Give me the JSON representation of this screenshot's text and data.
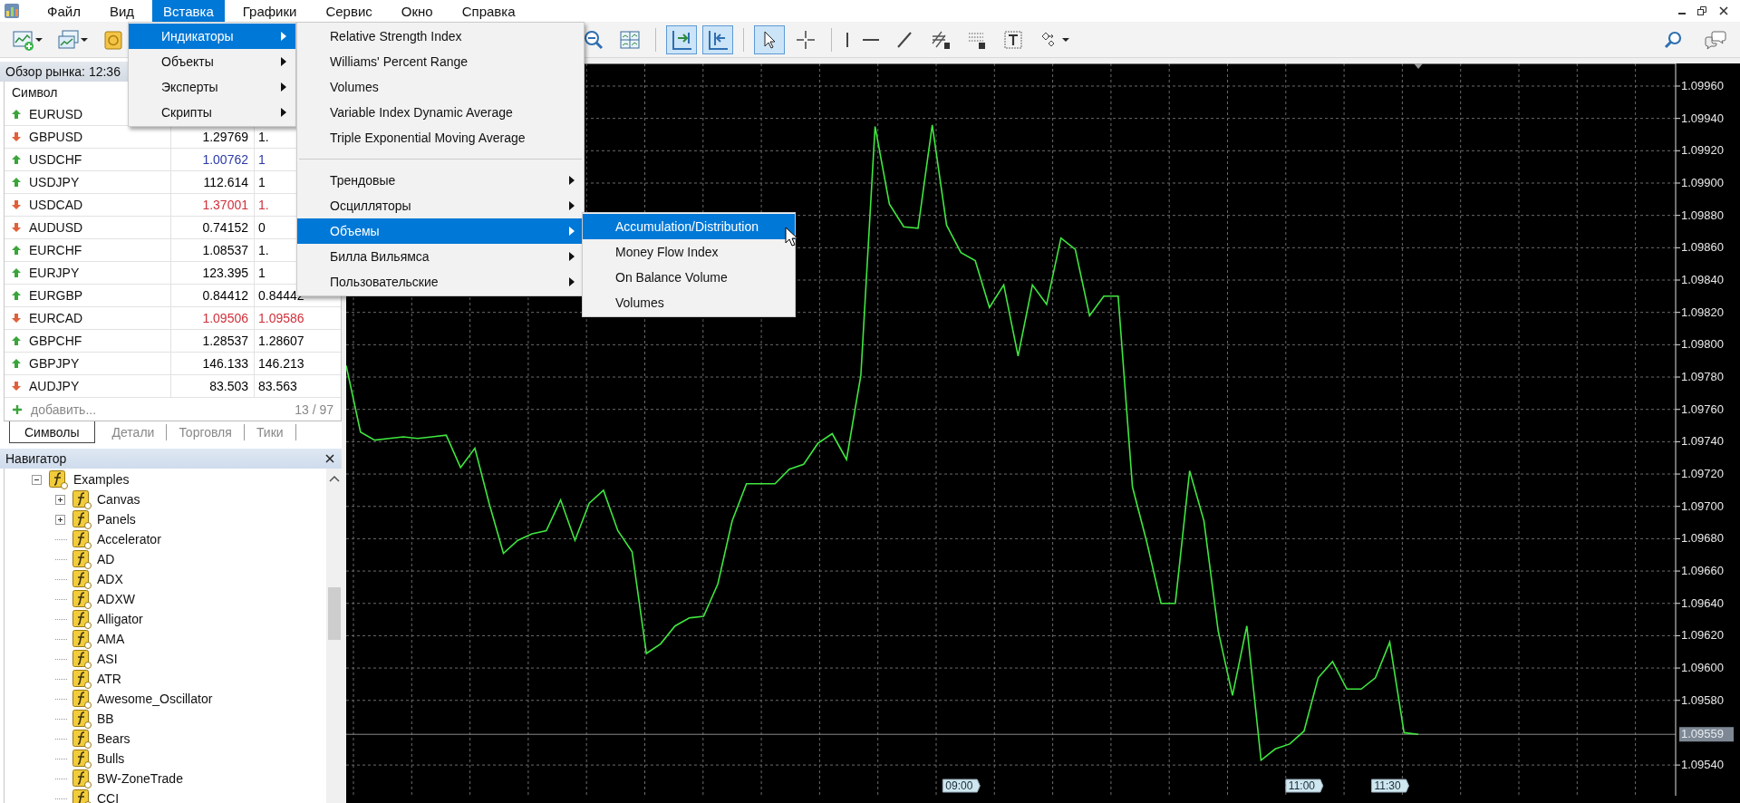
{
  "menu_bar": {
    "items": [
      {
        "label": "Файл",
        "selected": false
      },
      {
        "label": "Вид",
        "selected": false
      },
      {
        "label": "Вставка",
        "selected": true
      },
      {
        "label": "Графики",
        "selected": false
      },
      {
        "label": "Сервис",
        "selected": false
      },
      {
        "label": "Окно",
        "selected": false
      },
      {
        "label": "Справка",
        "selected": false
      }
    ]
  },
  "toolbar": {
    "left_group": [
      {
        "kind": "new-chart",
        "pressed": false,
        "dropdown": true
      },
      {
        "kind": "profiles",
        "pressed": false,
        "dropdown": true
      },
      {
        "kind": "coins",
        "pressed": false,
        "dropdown": false
      }
    ],
    "main_group": [
      {
        "kind": "zoom-out",
        "pressed": false,
        "dropdown": false
      },
      {
        "kind": "tile",
        "pressed": false,
        "dropdown": false
      },
      {
        "kind": "separator"
      },
      {
        "kind": "autoscroll",
        "pressed": true,
        "dropdown": false
      },
      {
        "kind": "chart-shift",
        "pressed": true,
        "dropdown": false
      },
      {
        "kind": "separator"
      },
      {
        "kind": "cursor",
        "pressed": true,
        "dropdown": false
      },
      {
        "kind": "crosshair",
        "pressed": false,
        "dropdown": false
      },
      {
        "kind": "separator"
      },
      {
        "kind": "vline",
        "pressed": false,
        "dropdown": false
      },
      {
        "kind": "hline",
        "pressed": false,
        "dropdown": false
      },
      {
        "kind": "trendline",
        "pressed": false,
        "dropdown": false
      },
      {
        "kind": "channel",
        "pressed": false,
        "dropdown": false
      },
      {
        "kind": "fibo",
        "pressed": false,
        "dropdown": false
      },
      {
        "kind": "text",
        "pressed": false,
        "dropdown": false
      },
      {
        "kind": "arrows",
        "pressed": false,
        "dropdown": true
      }
    ],
    "right_group": [
      {
        "kind": "search",
        "pressed": false,
        "dropdown": false
      },
      {
        "kind": "chat",
        "pressed": false,
        "dropdown": false
      }
    ]
  },
  "market_watch": {
    "title": "Обзор рынка: 12:36",
    "columns": [
      "Символ"
    ],
    "rows": [
      {
        "symbol": "EURUSD",
        "rising": true
      },
      {
        "symbol": "GBPUSD",
        "rising": false,
        "bid": "1.29769",
        "ask": "1.",
        "color": "#000000"
      },
      {
        "symbol": "USDCHF",
        "rising": true,
        "bid": "1.00762",
        "ask": "1",
        "color": "#2b3aa8"
      },
      {
        "symbol": "USDJPY",
        "rising": true,
        "bid": "112.614",
        "ask": "1",
        "color": "#000000"
      },
      {
        "symbol": "USDCAD",
        "rising": false,
        "bid": "1.37001",
        "ask": "1.",
        "color": "#d0303a"
      },
      {
        "symbol": "AUDUSD",
        "rising": false,
        "bid": "0.74152",
        "ask": "0",
        "color": "#000000"
      },
      {
        "symbol": "EURCHF",
        "rising": true,
        "bid": "1.08537",
        "ask": "1.",
        "color": "#000000"
      },
      {
        "symbol": "EURJPY",
        "rising": true,
        "bid": "123.395",
        "ask": "1",
        "color": "#000000"
      },
      {
        "symbol": "EURGBP",
        "rising": true,
        "bid": "0.84412",
        "ask": "0.84442",
        "color": "#000000"
      },
      {
        "symbol": "EURCAD",
        "rising": false,
        "bid": "1.09506",
        "ask": "1.09586",
        "color": "#d0303a"
      },
      {
        "symbol": "GBPCHF",
        "rising": true,
        "bid": "1.28537",
        "ask": "1.28607",
        "color": "#000000"
      },
      {
        "symbol": "GBPJPY",
        "rising": true,
        "bid": "146.133",
        "ask": "146.213",
        "color": "#000000"
      },
      {
        "symbol": "AUDJPY",
        "rising": false,
        "bid": "83.503",
        "ask": "83.563",
        "color": "#000000"
      }
    ],
    "add_label": "добавить...",
    "count": "13 / 97",
    "tabs": [
      {
        "label": "Символы",
        "selected": true
      },
      {
        "label": "Детали",
        "selected": false
      },
      {
        "label": "Торговля",
        "selected": false
      },
      {
        "label": "Тики",
        "selected": false
      }
    ]
  },
  "navigator": {
    "title": "Навигатор",
    "tree": [
      {
        "label": "Examples",
        "kind": "folder",
        "expanded": true,
        "children": [
          {
            "label": "Canvas",
            "kind": "folder",
            "expanded": false
          },
          {
            "label": "Panels",
            "kind": "folder",
            "expanded": false
          },
          {
            "label": "Accelerator",
            "kind": "indicator"
          },
          {
            "label": "AD",
            "kind": "indicator"
          },
          {
            "label": "ADX",
            "kind": "indicator"
          },
          {
            "label": "ADXW",
            "kind": "indicator"
          },
          {
            "label": "Alligator",
            "kind": "indicator"
          },
          {
            "label": "AMA",
            "kind": "indicator"
          },
          {
            "label": "ASI",
            "kind": "indicator"
          },
          {
            "label": "ATR",
            "kind": "indicator"
          },
          {
            "label": "Awesome_Oscillator",
            "kind": "indicator"
          },
          {
            "label": "BB",
            "kind": "indicator"
          },
          {
            "label": "Bears",
            "kind": "indicator"
          },
          {
            "label": "Bulls",
            "kind": "indicator"
          },
          {
            "label": "BW-ZoneTrade",
            "kind": "indicator"
          },
          {
            "label": "CCI",
            "kind": "indicator"
          }
        ]
      }
    ]
  },
  "chart": {
    "chart_data": {
      "type": "line",
      "grid": true,
      "ylim": [
        1.09521,
        1.09974
      ],
      "categories": [
        null,
        null,
        null,
        null,
        null,
        null,
        null,
        null,
        null,
        null,
        null,
        null,
        null,
        null,
        null,
        null,
        null,
        null,
        null,
        null,
        null,
        null,
        null,
        null,
        null,
        null,
        null,
        null,
        null,
        null,
        null,
        null,
        null,
        null,
        null,
        null,
        null,
        null,
        null,
        null,
        null,
        null,
        null,
        "09:00",
        null,
        null,
        null,
        null,
        null,
        null,
        null,
        null,
        null,
        null,
        null,
        null,
        null,
        null,
        null,
        null,
        null,
        null,
        null,
        null,
        null,
        null,
        null,
        "11:00",
        null,
        null,
        null,
        null,
        null,
        "11:30",
        null,
        null
      ],
      "yticks": [
        {
          "value": 1.0996,
          "label": "1.09960"
        },
        {
          "value": 1.0994,
          "label": "1.09940"
        },
        {
          "value": 1.0992,
          "label": "1.09920"
        },
        {
          "value": 1.099,
          "label": "1.09900"
        },
        {
          "value": 1.0988,
          "label": "1.09880"
        },
        {
          "value": 1.0986,
          "label": "1.09860"
        },
        {
          "value": 1.0984,
          "label": "1.09840"
        },
        {
          "value": 1.0982,
          "label": "1.09820"
        },
        {
          "value": 1.098,
          "label": "1.09800"
        },
        {
          "value": 1.0978,
          "label": "1.09780"
        },
        {
          "value": 1.0976,
          "label": "1.09760"
        },
        {
          "value": 1.0974,
          "label": "1.09740"
        },
        {
          "value": 1.0972,
          "label": "1.09720"
        },
        {
          "value": 1.097,
          "label": "1.09700"
        },
        {
          "value": 1.0968,
          "label": "1.09680"
        },
        {
          "value": 1.0966,
          "label": "1.09660"
        },
        {
          "value": 1.0964,
          "label": "1.09640"
        },
        {
          "value": 1.0962,
          "label": "1.09620"
        },
        {
          "value": 1.096,
          "label": "1.09600"
        },
        {
          "value": 1.0958,
          "label": "1.09580"
        },
        {
          "value": 1.0954,
          "label": "1.09540"
        }
      ],
      "series": [
        {
          "color": "#3fe63f",
          "values": [
            1.09787,
            1.09746,
            1.09741,
            1.09742,
            1.09743,
            1.09742,
            1.09743,
            1.09744,
            1.09724,
            1.09736,
            1.09702,
            1.09671,
            1.09679,
            1.09683,
            1.09685,
            1.09704,
            1.09679,
            1.09702,
            1.0971,
            1.09685,
            1.09672,
            1.09609,
            1.09615,
            1.09626,
            1.09631,
            1.09632,
            1.09652,
            1.09691,
            1.09714,
            1.09714,
            1.09714,
            1.09723,
            1.09726,
            1.09739,
            1.09745,
            1.09729,
            1.09781,
            1.09935,
            1.09887,
            1.09873,
            1.09872,
            1.09936,
            1.09874,
            1.09857,
            1.09852,
            1.09823,
            1.09837,
            1.09793,
            1.09837,
            1.09825,
            1.09866,
            1.09859,
            1.09818,
            1.0983,
            1.0983,
            1.09712,
            1.09678,
            1.0964,
            1.0964,
            1.09722,
            1.09691,
            1.09623,
            1.09583,
            1.09626,
            1.09543,
            1.0955,
            1.09553,
            1.09561,
            1.09594,
            1.09604,
            1.09587,
            1.09587,
            1.09594,
            1.09616,
            1.0956,
            1.09559
          ]
        }
      ],
      "ref_lines": [
        {
          "axis": "y",
          "value": 1.09559,
          "label": "1.09559",
          "color": "#8a8a8a"
        }
      ]
    }
  },
  "open_menus": [
    {
      "items": [
        {
          "label": "Индикаторы",
          "selected": true,
          "submenu": true
        },
        {
          "label": "Объекты",
          "selected": false,
          "submenu": true
        },
        {
          "label": "Эксперты",
          "selected": false,
          "submenu": true
        },
        {
          "label": "Скрипты",
          "selected": false,
          "submenu": true
        }
      ]
    },
    {
      "items": [
        {
          "kind": "item",
          "label": "Relative Strength Index",
          "selected": false,
          "submenu": false
        },
        {
          "kind": "item",
          "label": "Williams' Percent Range",
          "selected": false,
          "submenu": false
        },
        {
          "kind": "item",
          "label": "Volumes",
          "selected": false,
          "submenu": false
        },
        {
          "kind": "item",
          "label": "Variable Index Dynamic Average",
          "selected": false,
          "submenu": false
        },
        {
          "kind": "item",
          "label": "Triple Exponential Moving Average",
          "selected": false,
          "submenu": false
        },
        {
          "kind": "separator"
        },
        {
          "kind": "item",
          "label": "Трендовые",
          "selected": false,
          "submenu": true
        },
        {
          "kind": "item",
          "label": "Осцилляторы",
          "selected": false,
          "submenu": true
        },
        {
          "kind": "item",
          "label": "Объемы",
          "selected": true,
          "submenu": true
        },
        {
          "kind": "item",
          "label": "Билла Вильямса",
          "selected": false,
          "submenu": true
        },
        {
          "kind": "item",
          "label": "Пользовательские",
          "selected": false,
          "submenu": true
        }
      ]
    },
    {
      "items": [
        {
          "label": "Accumulation/Distribution",
          "selected": true,
          "submenu": false
        },
        {
          "label": "Money Flow Index",
          "selected": false,
          "submenu": false
        },
        {
          "label": "On Balance Volume",
          "selected": false,
          "submenu": false
        },
        {
          "label": "Volumes",
          "selected": false,
          "submenu": false
        }
      ]
    }
  ]
}
